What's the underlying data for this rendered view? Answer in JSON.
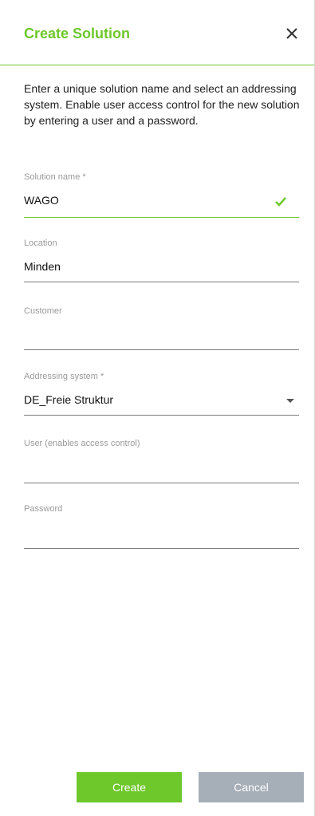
{
  "dialog": {
    "title": "Create Solution",
    "close_icon": "close-icon",
    "intro": "Enter a unique solution name and select an addressing system. Enable user access control for the new solution by entering a user and a password."
  },
  "fields": {
    "solution_name": {
      "label": "Solution name  *",
      "value": "WAGO",
      "status_icon": "check-icon"
    },
    "location": {
      "label": "Location",
      "value": "Minden"
    },
    "customer": {
      "label": "Customer",
      "value": ""
    },
    "addressing_system": {
      "label": "Addressing system  *",
      "value": "DE_Freie Struktur",
      "icon": "dropdown-arrow-icon"
    },
    "user": {
      "label": "User (enables access control)",
      "value": ""
    },
    "password": {
      "label": "Password",
      "value": ""
    }
  },
  "buttons": {
    "create": "Create",
    "cancel": "Cancel"
  },
  "colors": {
    "accent": "#6ec72b",
    "cancel_bg": "#a6aeb7",
    "label": "#9a9a9a"
  }
}
